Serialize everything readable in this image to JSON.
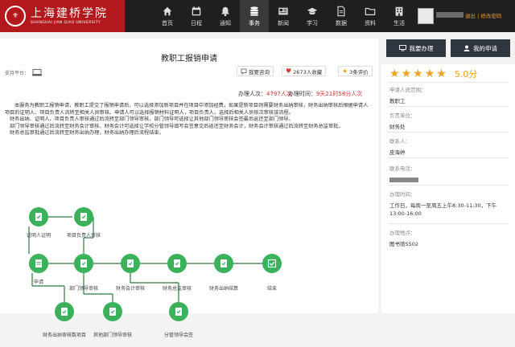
{
  "header": {
    "logo_text_cn": "上海建桥学院",
    "logo_text_en": "SHANGHAI JIAN QIAO UNIVERSITY",
    "nav": [
      {
        "label": "首页",
        "icon": "home-icon"
      },
      {
        "label": "日程",
        "icon": "calendar-icon"
      },
      {
        "label": "通知",
        "icon": "bell-icon"
      },
      {
        "label": "事务",
        "icon": "database-icon",
        "active": true
      },
      {
        "label": "新闻",
        "icon": "newspaper-icon"
      },
      {
        "label": "学习",
        "icon": "graduation-cap-icon"
      },
      {
        "label": "数据",
        "icon": "document-icon"
      },
      {
        "label": "资料",
        "icon": "folder-icon"
      },
      {
        "label": "生活",
        "icon": "building-icon"
      }
    ],
    "user_links": {
      "logout": "退出",
      "separator": "|",
      "change_password": "修改密码"
    }
  },
  "main": {
    "title": "教职工报销申请",
    "support_platform_label": "支持平台：",
    "actions": {
      "consult": "我要咨询",
      "favorites": "2673人收藏",
      "reviews": "3条评价"
    },
    "stats": {
      "handlers_label": "办理人次：",
      "handlers_value": "4797人次",
      "duration_label": "办理时间：",
      "duration_value": "9天21时58分人次"
    },
    "description": [
      "本服务为教职工报销申请，教职工提交了报销申请后，可以选择添加新项目并在项目中添加经费，如果是新项目则需要财务出纳审核，财务出纳审核后根据申请人项目的证明人、项目负责人流转至相关人员审核。申请人可以选择报销材料证明人，项目负责人，选择后相关人员依次审核该流程。",
      "财务出纳、证明人、项目负责人审核通过后流转至部门领导审核，部门领导可选择让其他部门领导审核会签最后返还至部门领导。",
      "部门领导审核通过后流转至财务会计审核，财务会计可选择让学校分管领导填写会签意见后返还至财务会计，财务会计审核通过后流转至财务总监审批。",
      "财务总监审批通过后流转至财务出纳办理，财务出纳办理后流程结束。"
    ],
    "flow_nodes": [
      "证明人证明",
      "项目负责人审核",
      "申请",
      "部门领导审核",
      "财务会计审核",
      "财务总监审核",
      "财务出纳结算",
      "结束",
      "财务出纳审核数项目",
      "其他部门领导审核",
      "分管领导会签"
    ]
  },
  "sidebar": {
    "tabs": {
      "my_tasks": "我要办理",
      "my_applications": "我的申请"
    },
    "rating": {
      "stars": 5,
      "score": "5.0分"
    },
    "fields": [
      {
        "label": "申请人员范围：",
        "value": "教职工"
      },
      {
        "label": "负责单位：",
        "value": "财务处"
      },
      {
        "label": "联系人：",
        "value": "皮海婷"
      },
      {
        "label": "联系电话：",
        "value": ""
      },
      {
        "label": "办理时间：",
        "value": "工作日，每周一至周五上午8:30-11:30，下午13:00-16:00"
      },
      {
        "label": "办理地点：",
        "value": "图书馆S502"
      }
    ]
  },
  "colors": {
    "brand": "#b3181c",
    "accent": "#3bb15b",
    "topbar": "#1f1f1f",
    "highlight": "#d9342b",
    "star": "#f0a21e"
  }
}
